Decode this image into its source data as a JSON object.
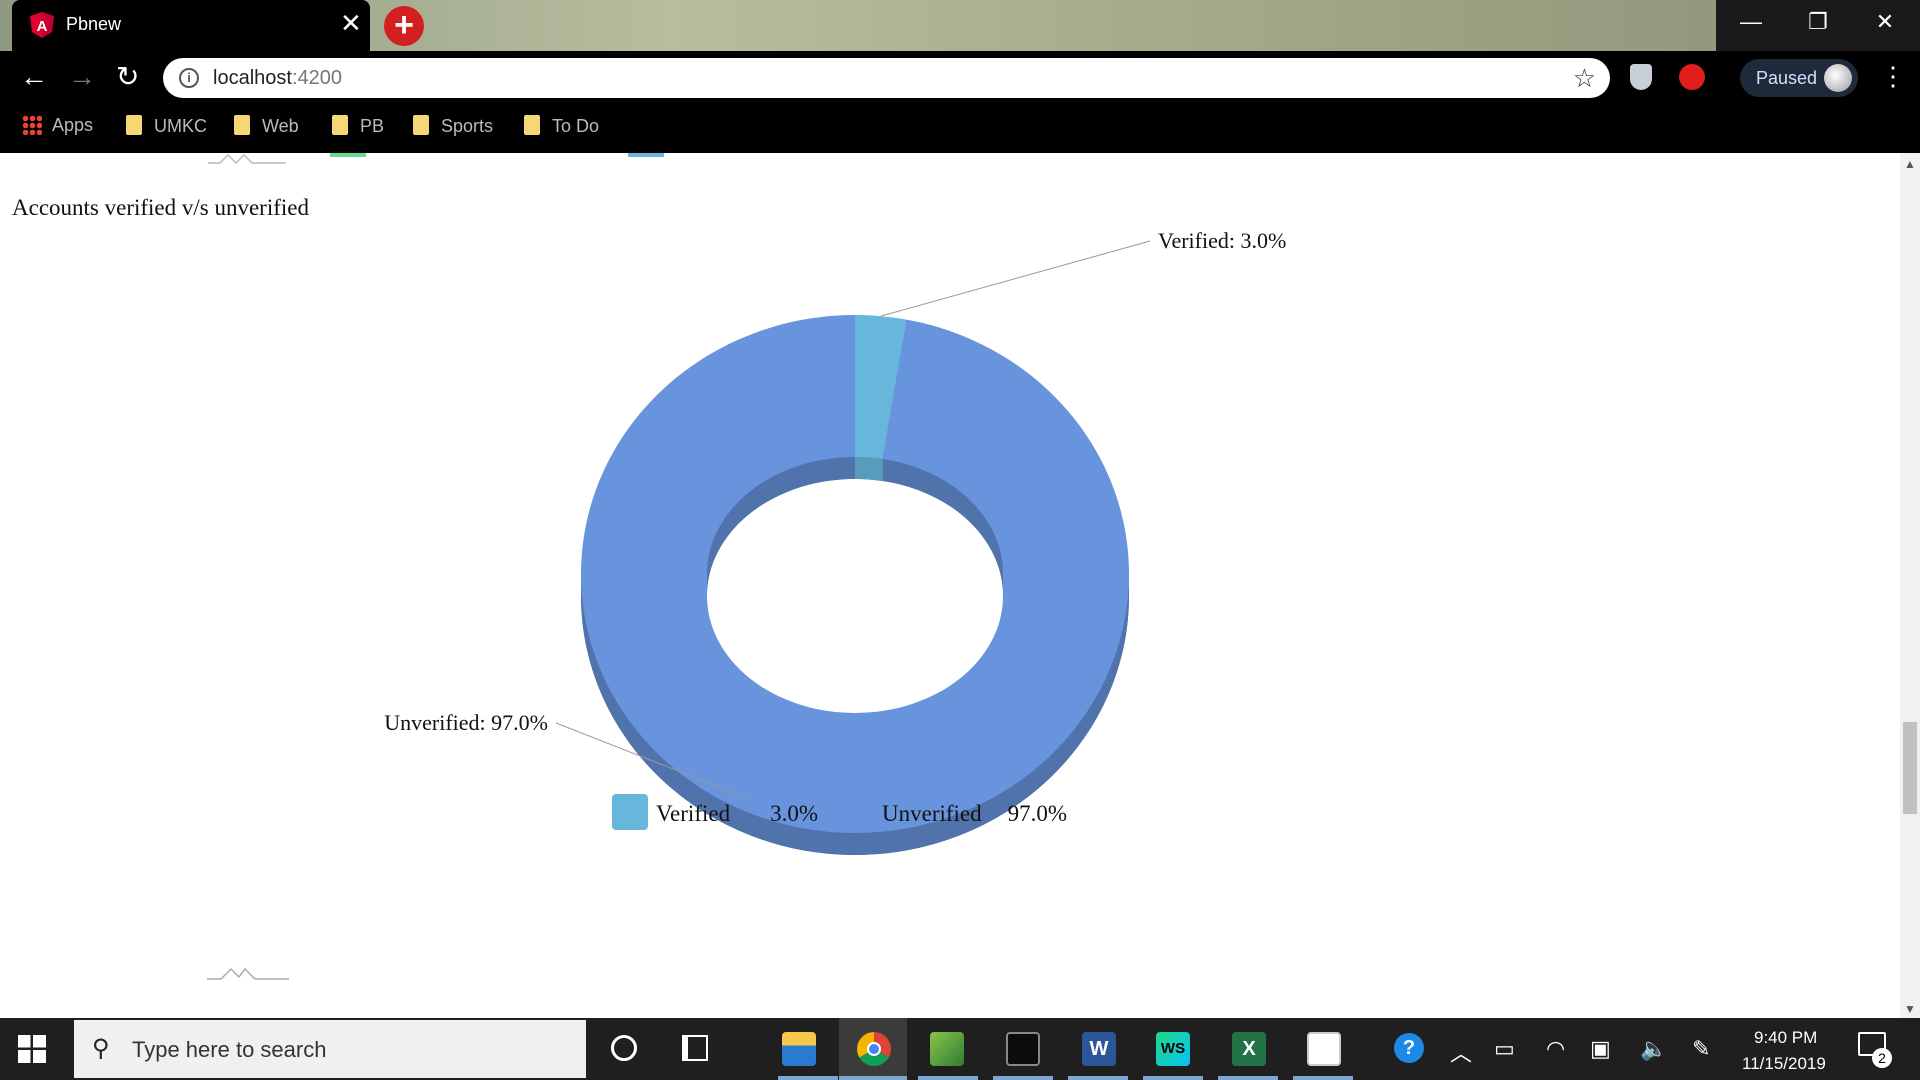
{
  "browser": {
    "tab_title": "Pbnew",
    "tab_close": "✕",
    "new_tab": "+",
    "window_controls": {
      "minimize": "—",
      "restore": "❐",
      "close": "✕"
    },
    "nav": {
      "back": "←",
      "forward": "→",
      "reload": "↻"
    },
    "url_host": "localhost",
    "url_port": ":4200",
    "star": "☆",
    "profile_label": "Paused",
    "menu": "⋮",
    "bookmarks": [
      {
        "label": "Apps",
        "icon": "apps-grid-icon"
      },
      {
        "label": "UMKC",
        "icon": "folder-icon"
      },
      {
        "label": "Web",
        "icon": "folder-icon"
      },
      {
        "label": "PB",
        "icon": "folder-icon"
      },
      {
        "label": "Sports",
        "icon": "folder-icon"
      },
      {
        "label": "To Do",
        "icon": "folder-icon"
      }
    ]
  },
  "page": {
    "heading": "Accounts verified v/s unverified"
  },
  "chart_data": {
    "type": "pie",
    "variant": "3d-donut",
    "title": "Accounts verified v/s unverified",
    "categories": [
      "Verified",
      "Unverified"
    ],
    "values": [
      3.0,
      97.0
    ],
    "unit": "%",
    "colors": [
      "#67b7dc",
      "#6794dc"
    ],
    "slice_labels": [
      "Verified: 3.0%",
      "Unverified: 97.0%"
    ],
    "legend": {
      "placement": "bottom",
      "items": [
        {
          "name": "Verified",
          "value": "3.0%"
        },
        {
          "name": "Unverified",
          "value": "97.0%"
        }
      ]
    }
  },
  "taskbar": {
    "search_placeholder": "Type here to search",
    "time": "9:40 PM",
    "date": "11/15/2019",
    "notification_count": "2",
    "apps": [
      "cortana-icon",
      "task-view-icon",
      "file-explorer-icon",
      "chrome-icon",
      "paint-icon",
      "terminal-icon",
      "word-icon",
      "webstorm-icon",
      "excel-icon",
      "photos-icon"
    ]
  }
}
